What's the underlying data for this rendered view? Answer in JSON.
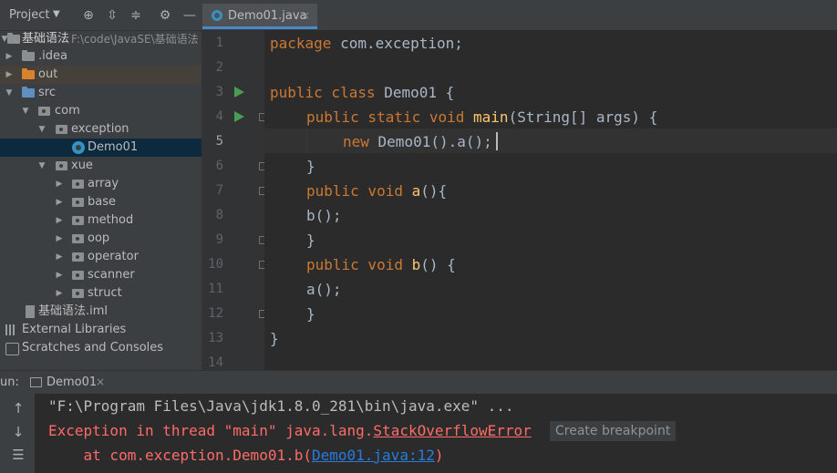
{
  "project": {
    "title": "Project",
    "root": {
      "name": "基础语法",
      "path": "F:\\code\\JavaSE\\基础语法"
    },
    "tree": [
      {
        "label": ".idea"
      },
      {
        "label": "out"
      },
      {
        "label": "src"
      },
      {
        "label": "com"
      },
      {
        "label": "exception"
      },
      {
        "label": "Demo01"
      },
      {
        "label": "xue"
      },
      {
        "label": "array"
      },
      {
        "label": "base"
      },
      {
        "label": "method"
      },
      {
        "label": "oop"
      },
      {
        "label": "operator"
      },
      {
        "label": "scanner"
      },
      {
        "label": "struct"
      },
      {
        "label": "基础语法.iml"
      },
      {
        "label": "External Libraries"
      },
      {
        "label": "Scratches and Consoles"
      }
    ]
  },
  "editor": {
    "tab": {
      "label": "Demo01.java",
      "close": "×"
    },
    "current_line": 5,
    "line_numbers": [
      "1",
      "2",
      "3",
      "4",
      "5",
      "6",
      "7",
      "8",
      "9",
      "10",
      "11",
      "12",
      "13",
      "14"
    ],
    "code": {
      "l1_kw": "package",
      "l1_rest": " com.exception;",
      "l3_kw": "public class",
      "l3_rest": " Demo01 {",
      "l4_kw": "public static void",
      "l4_fn": " main",
      "l4_rest": "(String[] args) {",
      "l5_kw": "new",
      "l5_rest": " Demo01().a();",
      "l6": "}",
      "l7_kw": "public void",
      "l7_fn": " a",
      "l7_rest": "(){",
      "l8": "b();",
      "l9": "}",
      "l10_kw": "public void",
      "l10_fn": " b",
      "l10_rest": "() {",
      "l11": "a();",
      "l12": "}",
      "l13": "}"
    }
  },
  "run": {
    "label": "un:",
    "tab": {
      "label": "Demo01",
      "close": "×"
    },
    "console": {
      "cmd": "\"F:\\Program Files\\Java\\jdk1.8.0_281\\bin\\java.exe\" ...",
      "exc_prefix": "Exception in thread \"main\" java.lang.",
      "exc_class": "StackOverflowError",
      "tooltip": "Create breakpoint",
      "at_prefix": "    at com.exception.Demo01.b(",
      "at_link": "Demo01.java:12",
      "at_suffix": ")"
    }
  },
  "colors": {
    "keyword": "#cc7832",
    "function": "#ffc66d",
    "error": "#ff6b68",
    "link": "#287bde",
    "accent": "#4a88c7"
  }
}
